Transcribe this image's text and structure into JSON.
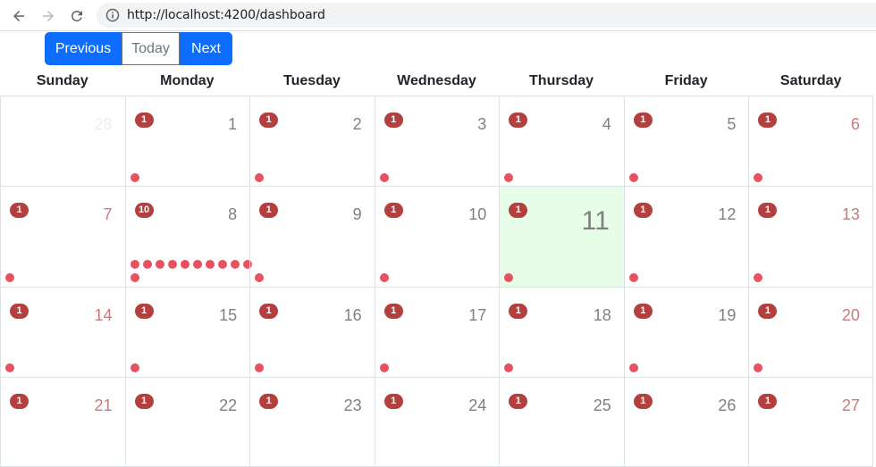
{
  "browser": {
    "url": "http://localhost:4200/dashboard"
  },
  "toolbar": {
    "previous_label": "Previous",
    "today_label": "Today",
    "next_label": "Next"
  },
  "calendar": {
    "weekdays": [
      "Sunday",
      "Monday",
      "Tuesday",
      "Wednesday",
      "Thursday",
      "Friday",
      "Saturday"
    ],
    "weeks": [
      [
        {
          "day": "28",
          "badge": "",
          "dots": 0,
          "faded": true
        },
        {
          "day": "1",
          "badge": "1",
          "dots": 1
        },
        {
          "day": "2",
          "badge": "1",
          "dots": 1
        },
        {
          "day": "3",
          "badge": "1",
          "dots": 1
        },
        {
          "day": "4",
          "badge": "1",
          "dots": 1
        },
        {
          "day": "5",
          "badge": "1",
          "dots": 1
        },
        {
          "day": "6",
          "badge": "1",
          "dots": 1
        }
      ],
      [
        {
          "day": "7",
          "badge": "1",
          "dots": 1
        },
        {
          "day": "8",
          "badge": "10",
          "dots": 10
        },
        {
          "day": "9",
          "badge": "1",
          "dots": 1
        },
        {
          "day": "10",
          "badge": "1",
          "dots": 1
        },
        {
          "day": "11",
          "badge": "1",
          "dots": 1,
          "today": true
        },
        {
          "day": "12",
          "badge": "1",
          "dots": 1
        },
        {
          "day": "13",
          "badge": "1",
          "dots": 1
        }
      ],
      [
        {
          "day": "14",
          "badge": "1",
          "dots": 1
        },
        {
          "day": "15",
          "badge": "1",
          "dots": 1
        },
        {
          "day": "16",
          "badge": "1",
          "dots": 1
        },
        {
          "day": "17",
          "badge": "1",
          "dots": 1
        },
        {
          "day": "18",
          "badge": "1",
          "dots": 1
        },
        {
          "day": "19",
          "badge": "1",
          "dots": 1
        },
        {
          "day": "20",
          "badge": "1",
          "dots": 1
        }
      ],
      [
        {
          "day": "21",
          "badge": "1",
          "dots": 0
        },
        {
          "day": "22",
          "badge": "1",
          "dots": 0
        },
        {
          "day": "23",
          "badge": "1",
          "dots": 0
        },
        {
          "day": "24",
          "badge": "1",
          "dots": 0
        },
        {
          "day": "25",
          "badge": "1",
          "dots": 0
        },
        {
          "day": "26",
          "badge": "1",
          "dots": 0
        },
        {
          "day": "27",
          "badge": "1",
          "dots": 0
        }
      ]
    ]
  },
  "colors": {
    "primary": "#0d6efd",
    "badge": "#b3403e",
    "dot": "#e8515f",
    "today_bg": "#e8fde7",
    "weekend_text": "#c97b7b"
  }
}
